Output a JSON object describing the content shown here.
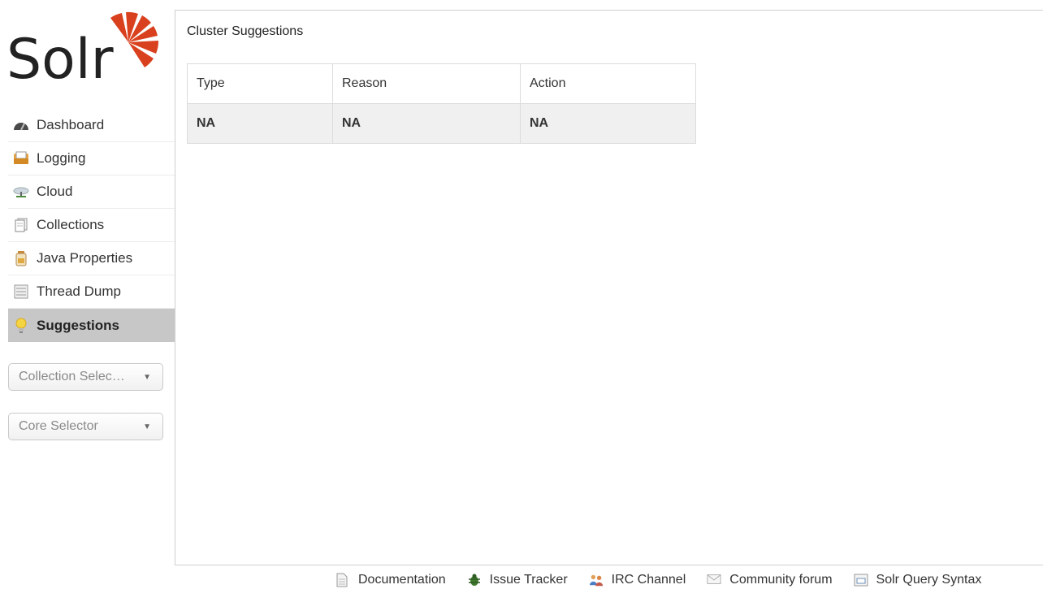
{
  "logo": {
    "text": "Solr",
    "color": "#d9411e"
  },
  "nav": {
    "items": [
      {
        "label": "Dashboard",
        "icon": "dashboard-icon"
      },
      {
        "label": "Logging",
        "icon": "logging-icon"
      },
      {
        "label": "Cloud",
        "icon": "cloud-icon"
      },
      {
        "label": "Collections",
        "icon": "collections-icon"
      },
      {
        "label": "Java Properties",
        "icon": "java-properties-icon"
      },
      {
        "label": "Thread Dump",
        "icon": "thread-dump-icon"
      },
      {
        "label": "Suggestions",
        "icon": "suggestions-icon",
        "active": true
      }
    ]
  },
  "selectors": {
    "collection": "Collection Selec…",
    "core": "Core Selector",
    "arrow": "▼"
  },
  "main": {
    "title": "Cluster Suggestions",
    "table": {
      "headers": [
        "Type",
        "Reason",
        "Action"
      ],
      "rows": [
        [
          "NA",
          "NA",
          "NA"
        ]
      ]
    }
  },
  "footer": {
    "links": [
      {
        "label": "Documentation",
        "icon": "documentation-icon"
      },
      {
        "label": "Issue Tracker",
        "icon": "bug-icon"
      },
      {
        "label": "IRC Channel",
        "icon": "irc-icon"
      },
      {
        "label": "Community forum",
        "icon": "mail-icon"
      },
      {
        "label": "Solr Query Syntax",
        "icon": "query-syntax-icon"
      }
    ]
  },
  "colors": {
    "active_nav_bg": "#c7c7c7",
    "border": "#dcdcdc",
    "row_bg": "#f0f0f0"
  }
}
